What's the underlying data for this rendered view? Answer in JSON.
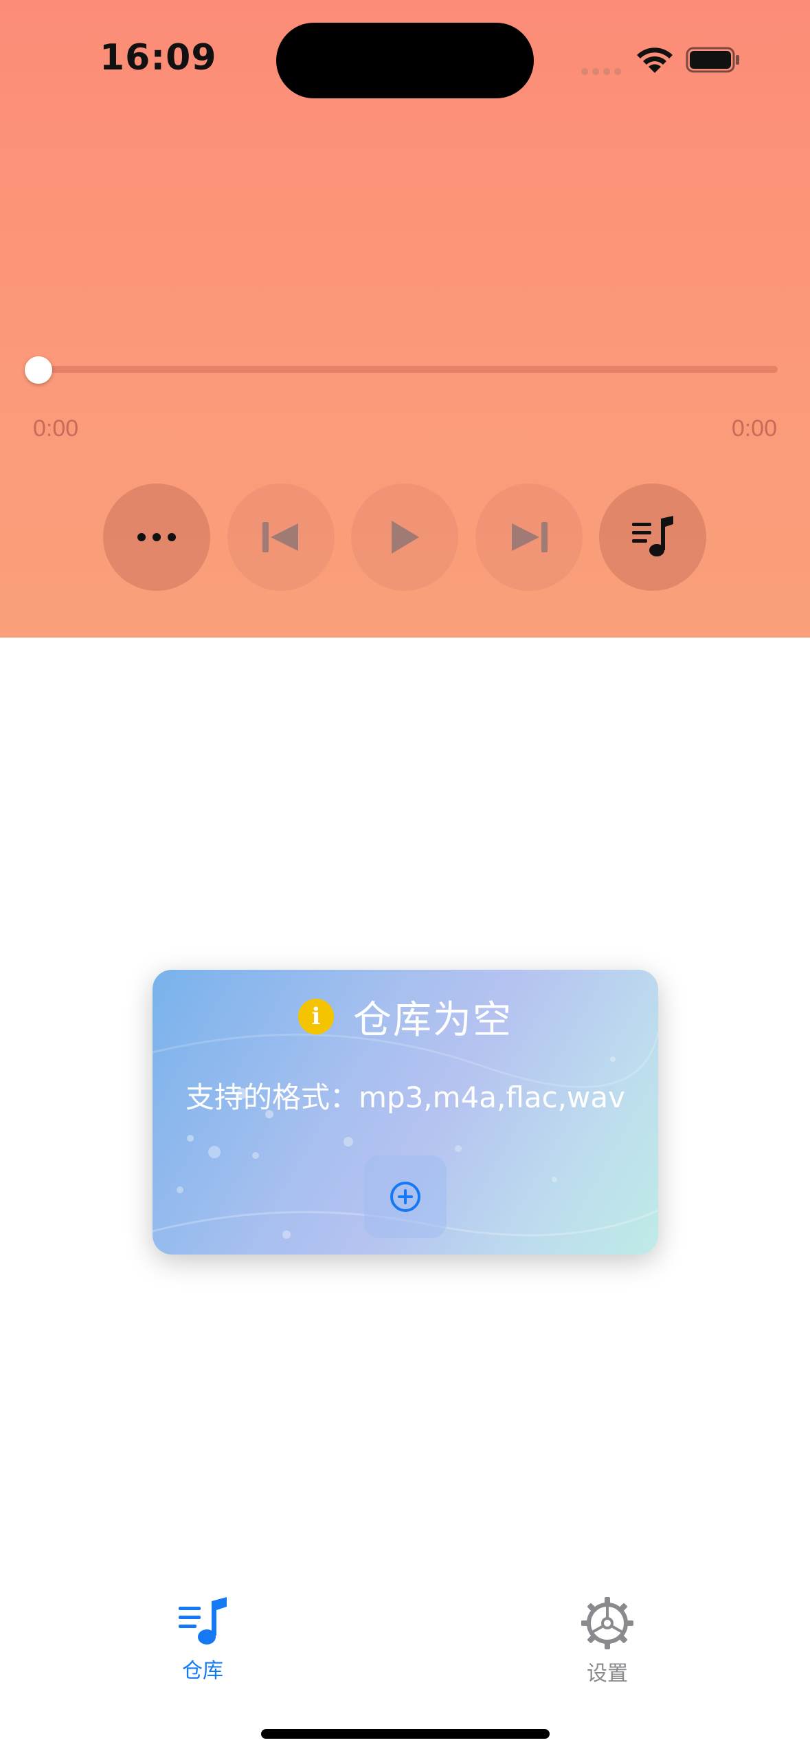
{
  "status_bar": {
    "time": "16:09"
  },
  "player": {
    "progress_fraction": 0.0,
    "elapsed": "0:00",
    "duration": "0:00",
    "controls": {
      "more": "more-icon",
      "previous": "previous-track-icon",
      "play": "play-icon",
      "next": "next-track-icon",
      "playlist": "playlist-icon"
    }
  },
  "empty_card": {
    "title": "仓库为空",
    "formats": "支持的格式：mp3,m4a,flac,wav",
    "info_glyph": "i",
    "add_icon": "plus-circle-icon"
  },
  "tabbar": {
    "items": [
      {
        "label": "仓库",
        "icon": "music-library-icon",
        "active": true
      },
      {
        "label": "设置",
        "icon": "settings-gear-icon",
        "active": false
      }
    ]
  },
  "colors": {
    "accent": "#1578f5",
    "player_bg": "#fc8c78",
    "inactive_tab": "#8a8a8e",
    "info_yellow": "#f5c400"
  }
}
